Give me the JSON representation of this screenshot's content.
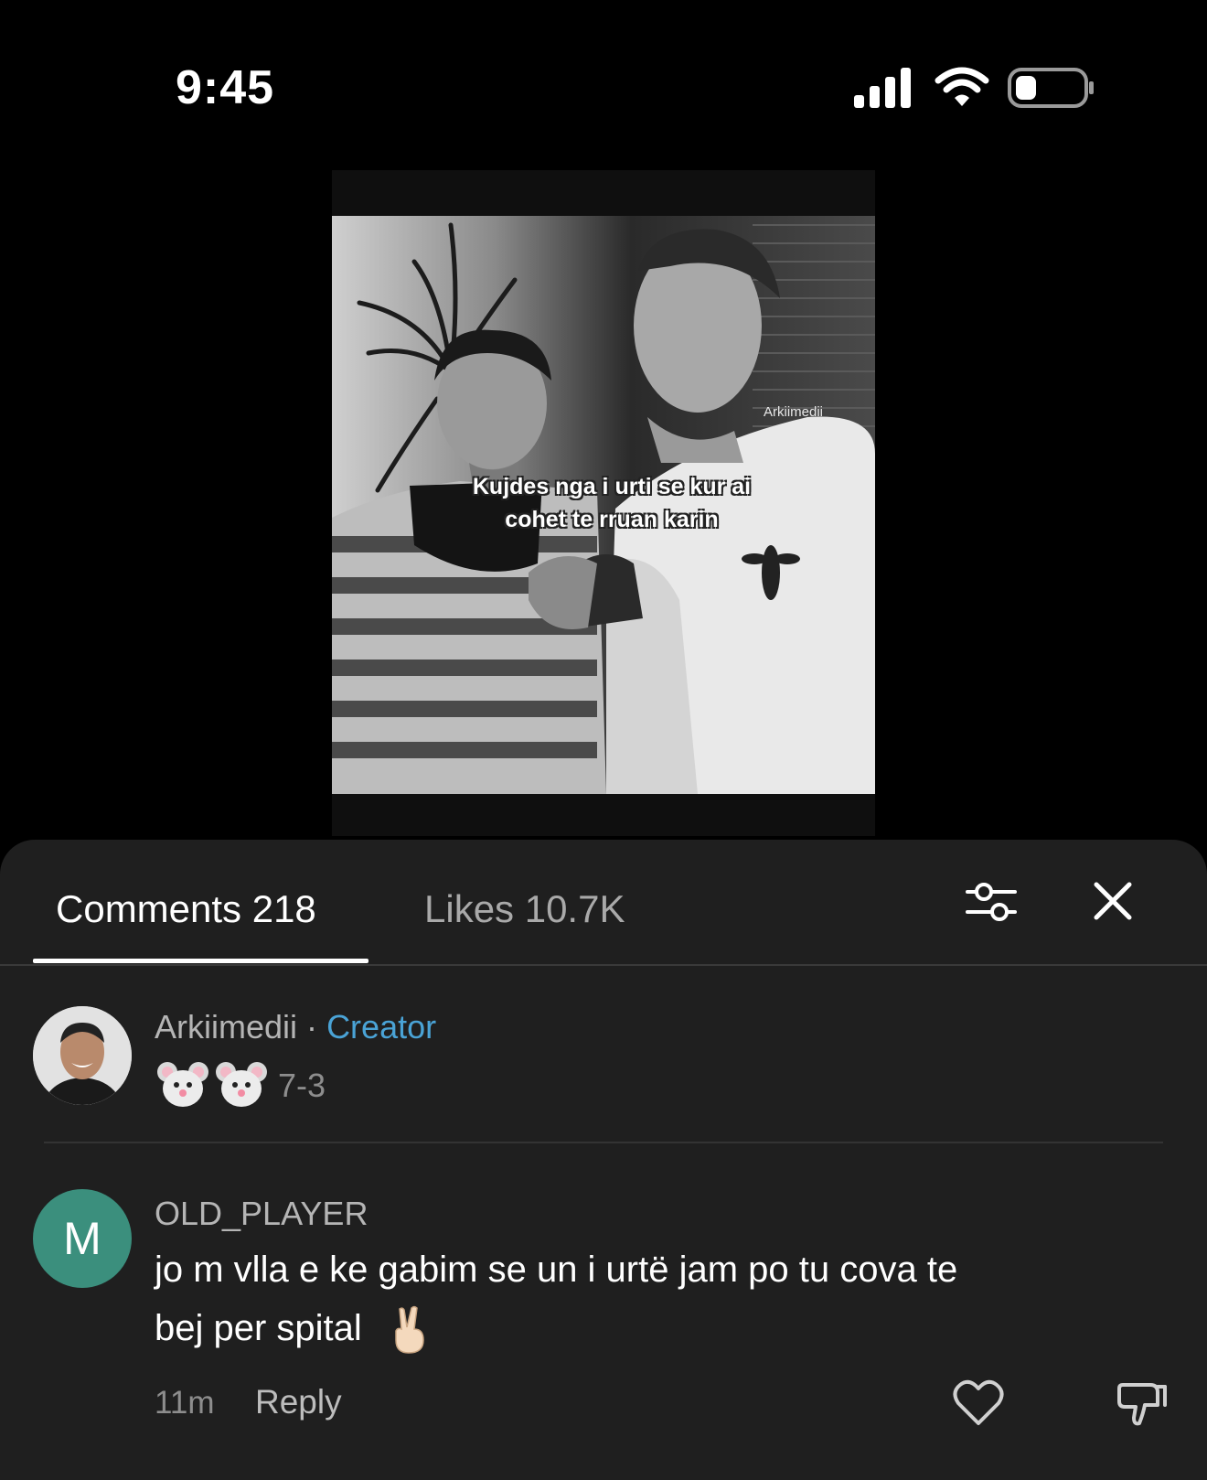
{
  "status_bar": {
    "time": "9:45"
  },
  "video": {
    "watermark": "Arkiimedii",
    "caption_line1": "Kujdes nga i urti se kur ai",
    "caption_line2": "cohet te rruan karin"
  },
  "comments_sheet": {
    "tabs": [
      {
        "label": "Comments 218",
        "active": true
      },
      {
        "label": "Likes 10.7K",
        "active": false
      }
    ],
    "comments": [
      {
        "username": "Arkiimedii",
        "separator": "·",
        "badge": "Creator",
        "emoji": "mouse-face x2",
        "date": "7-3"
      },
      {
        "avatar_letter": "M",
        "avatar_color": "#3b8f7d",
        "username": "OLD_PLAYER",
        "text_line1": "jo m vlla e ke gabim se un i urtë jam po tu cova te",
        "text_line2": "bej per spital",
        "emoji": "victory-hand",
        "time": "11m",
        "reply_label": "Reply"
      }
    ]
  },
  "colors": {
    "accent": "#4aa3d6",
    "sheet": "#1f1f1f",
    "avatar_m": "#3b8f7d"
  }
}
